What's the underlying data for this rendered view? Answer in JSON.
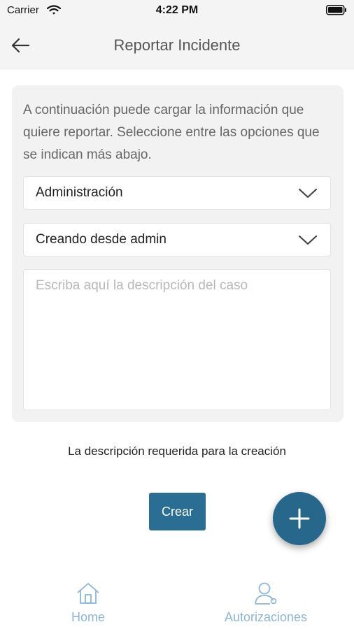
{
  "status_bar": {
    "carrier": "Carrier",
    "time": "4:22 PM"
  },
  "header": {
    "title": "Reportar Incidente"
  },
  "form": {
    "intro": "A continuación puede cargar la información que quiere reportar. Seleccione entre las opciones que se indican más abajo.",
    "category_value": "Administración",
    "subcategory_value": "Creando desde admin",
    "description_placeholder": "Escriba aquí la descripción del caso",
    "description_value": "",
    "helper_text": "La descripción requerida para la creación",
    "submit_label": "Crear"
  },
  "bottom_nav": {
    "items": [
      {
        "label": "Home",
        "icon": "home-icon"
      },
      {
        "label": "Autorizaciones",
        "icon": "user-icon"
      }
    ]
  },
  "colors": {
    "primary": "#2a6e94",
    "nav_inactive": "#8cb6d6",
    "header_bg": "#f4f4f4",
    "card_bg": "#f2f2f2"
  }
}
